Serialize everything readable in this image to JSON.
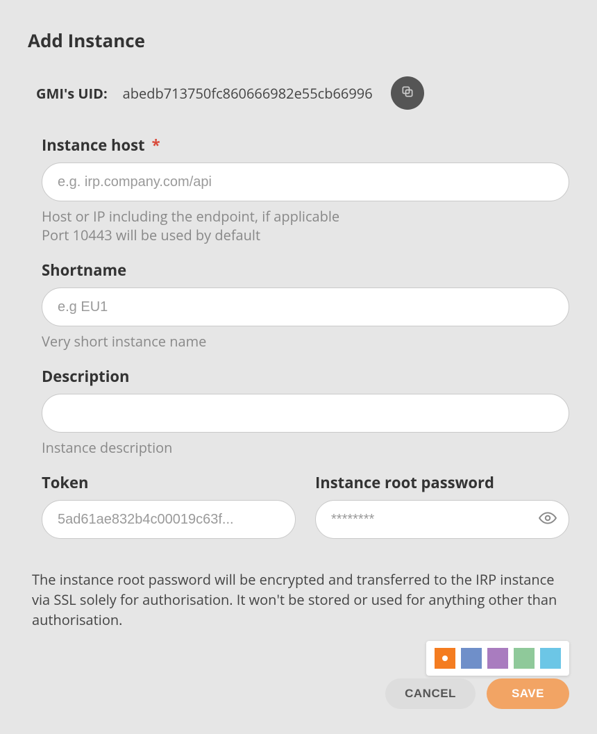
{
  "title": "Add Instance",
  "uid": {
    "label": "GMI's UID:",
    "value": "abedb713750fc860666982e55cb66996"
  },
  "fields": {
    "host": {
      "label": "Instance host",
      "required_mark": "*",
      "placeholder": "e.g. irp.company.com/api",
      "value": "",
      "helper": "Host or IP including the endpoint, if applicable\nPort 10443 will be used by default"
    },
    "shortname": {
      "label": "Shortname",
      "placeholder": "e.g EU1",
      "value": "",
      "helper": "Very short instance name"
    },
    "description": {
      "label": "Description",
      "placeholder": "",
      "value": "",
      "helper": "Instance description"
    },
    "token": {
      "label": "Token",
      "placeholder": "5ad61ae832b4c00019c63f...",
      "value": ""
    },
    "password": {
      "label": "Instance root password",
      "placeholder": "********",
      "value": ""
    }
  },
  "disclaimer": "The instance root password will be encrypted and transferred to the IRP instance via SSL solely for authorisation. It won't be stored or used for anything other than authorisation.",
  "colors": {
    "options": [
      "#f47c20",
      "#6f8fc9",
      "#a97cbf",
      "#8fc99a",
      "#6cc6e6"
    ],
    "selected_index": 0
  },
  "actions": {
    "cancel": "CANCEL",
    "save": "SAVE"
  }
}
